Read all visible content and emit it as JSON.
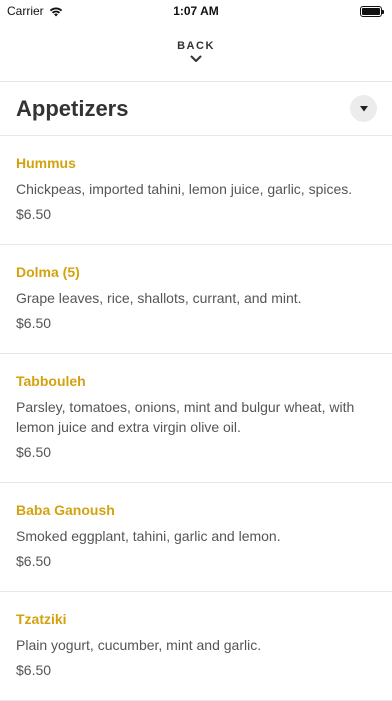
{
  "status_bar": {
    "carrier": "Carrier",
    "time": "1:07 AM"
  },
  "nav": {
    "back_label": "BACK"
  },
  "section": {
    "title": "Appetizers"
  },
  "items": [
    {
      "name": "Hummus",
      "description": "Chickpeas, imported tahini, lemon juice, garlic, spices.",
      "price": "$6.50"
    },
    {
      "name": "Dolma (5)",
      "description": "Grape leaves, rice, shallots, currant, and mint.",
      "price": "$6.50"
    },
    {
      "name": "Tabbouleh",
      "description": "Parsley, tomatoes, onions, mint and bulgur wheat, with lemon juice and extra virgin olive oil.",
      "price": "$6.50"
    },
    {
      "name": "Baba Ganoush",
      "description": "Smoked eggplant, tahini, garlic and lemon.",
      "price": "$6.50"
    },
    {
      "name": "Tzatziki",
      "description": "Plain yogurt, cucumber, mint and garlic.",
      "price": "$6.50"
    }
  ],
  "colors": {
    "accent": "#d4a20e",
    "divider": "#e8e8e8"
  }
}
